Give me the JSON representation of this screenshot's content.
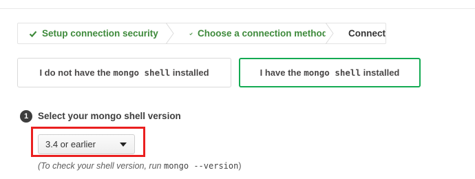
{
  "breadcrumb": {
    "steps": [
      {
        "label": "Setup connection security",
        "status": "done",
        "icon": "check-icon"
      },
      {
        "label": "Choose a connection method",
        "status": "done",
        "icon": "check-icon"
      },
      {
        "label": "Connect",
        "status": "current"
      }
    ]
  },
  "shell_options": {
    "not_installed": {
      "prefix": "I do not have the",
      "code": "mongo shell",
      "suffix": "installed"
    },
    "installed": {
      "prefix": "I have the",
      "code": "mongo shell",
      "suffix": "installed",
      "selected": true
    }
  },
  "section": {
    "number": "1",
    "title": "Select your mongo shell version"
  },
  "version_select": {
    "value": "3.4 or earlier"
  },
  "hint": {
    "prefix": "(To check your shell version, run",
    "command": "mongo --version",
    "suffix": ")"
  },
  "colors": {
    "done_green": "#3e8a3b",
    "selected_border": "#13aa52",
    "highlight_red": "#ea1f1f"
  }
}
